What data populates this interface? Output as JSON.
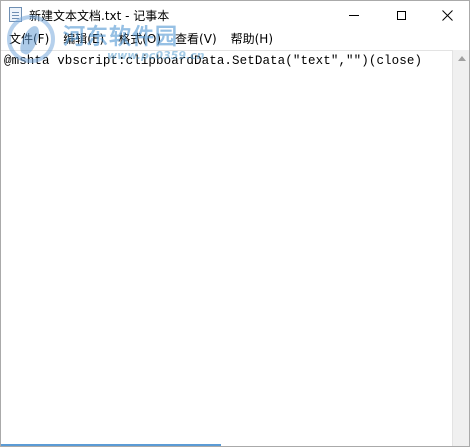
{
  "window": {
    "title": "新建文本文档.txt - 记事本"
  },
  "menu": [
    {
      "label": "文件(F)"
    },
    {
      "label": "编辑(E)"
    },
    {
      "label": "格式(O)"
    },
    {
      "label": "查看(V)"
    },
    {
      "label": "帮助(H)"
    }
  ],
  "editor": {
    "content": "@mshta vbscript:clipboardData.SetData(\"text\",\"\")(close)"
  },
  "watermark": {
    "name": "河东软件园",
    "url": "www.pc0359.cn"
  },
  "colors": {
    "accent": "#5b9bd5",
    "titlebar": "#ffffff",
    "scrollbar": "#f0f0f0"
  },
  "icons": {
    "app": "notepad-icon",
    "minimize": "minimize-icon",
    "maximize": "maximize-icon",
    "close": "close-icon"
  }
}
